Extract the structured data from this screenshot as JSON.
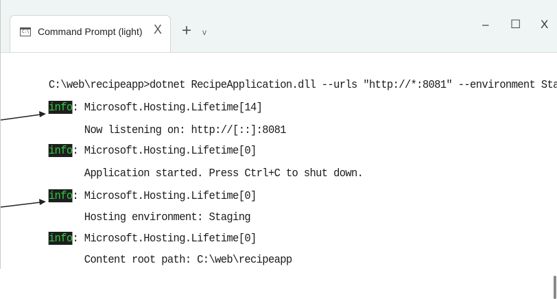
{
  "window": {
    "tab_title": "Command Prompt (light) - dot",
    "tab_icon_text": "C:\\",
    "close_tab": "X",
    "new_tab": "+",
    "dropdown": "v",
    "minimize": "–",
    "maximize": "☐",
    "close": "X"
  },
  "terminal": {
    "lines": [
      {
        "tag": "",
        "text": "C:\\web\\recipeapp>dotnet RecipeApplication.dll --urls \"http://*:8081\" --environment Staging"
      },
      {
        "tag": "info",
        "text": ": Microsoft.Hosting.Lifetime[14]"
      },
      {
        "tag": "",
        "text": "      Now listening on: http://[::]:8081"
      },
      {
        "tag": "info",
        "text": ": Microsoft.Hosting.Lifetime[0]"
      },
      {
        "tag": "",
        "text": "      Application started. Press Ctrl+C to shut down."
      },
      {
        "tag": "info",
        "text": ": Microsoft.Hosting.Lifetime[0]"
      },
      {
        "tag": "",
        "text": "      Hosting environment: Staging"
      },
      {
        "tag": "info",
        "text": ": Microsoft.Hosting.Lifetime[0]"
      },
      {
        "tag": "",
        "text": "      Content root path: C:\\web\\recipeapp"
      }
    ]
  },
  "colors": {
    "titlebar": "#eef5f4",
    "info_bg": "#1e1e1e",
    "info_fg": "#2ecc40",
    "text": "#1a1a1a"
  }
}
